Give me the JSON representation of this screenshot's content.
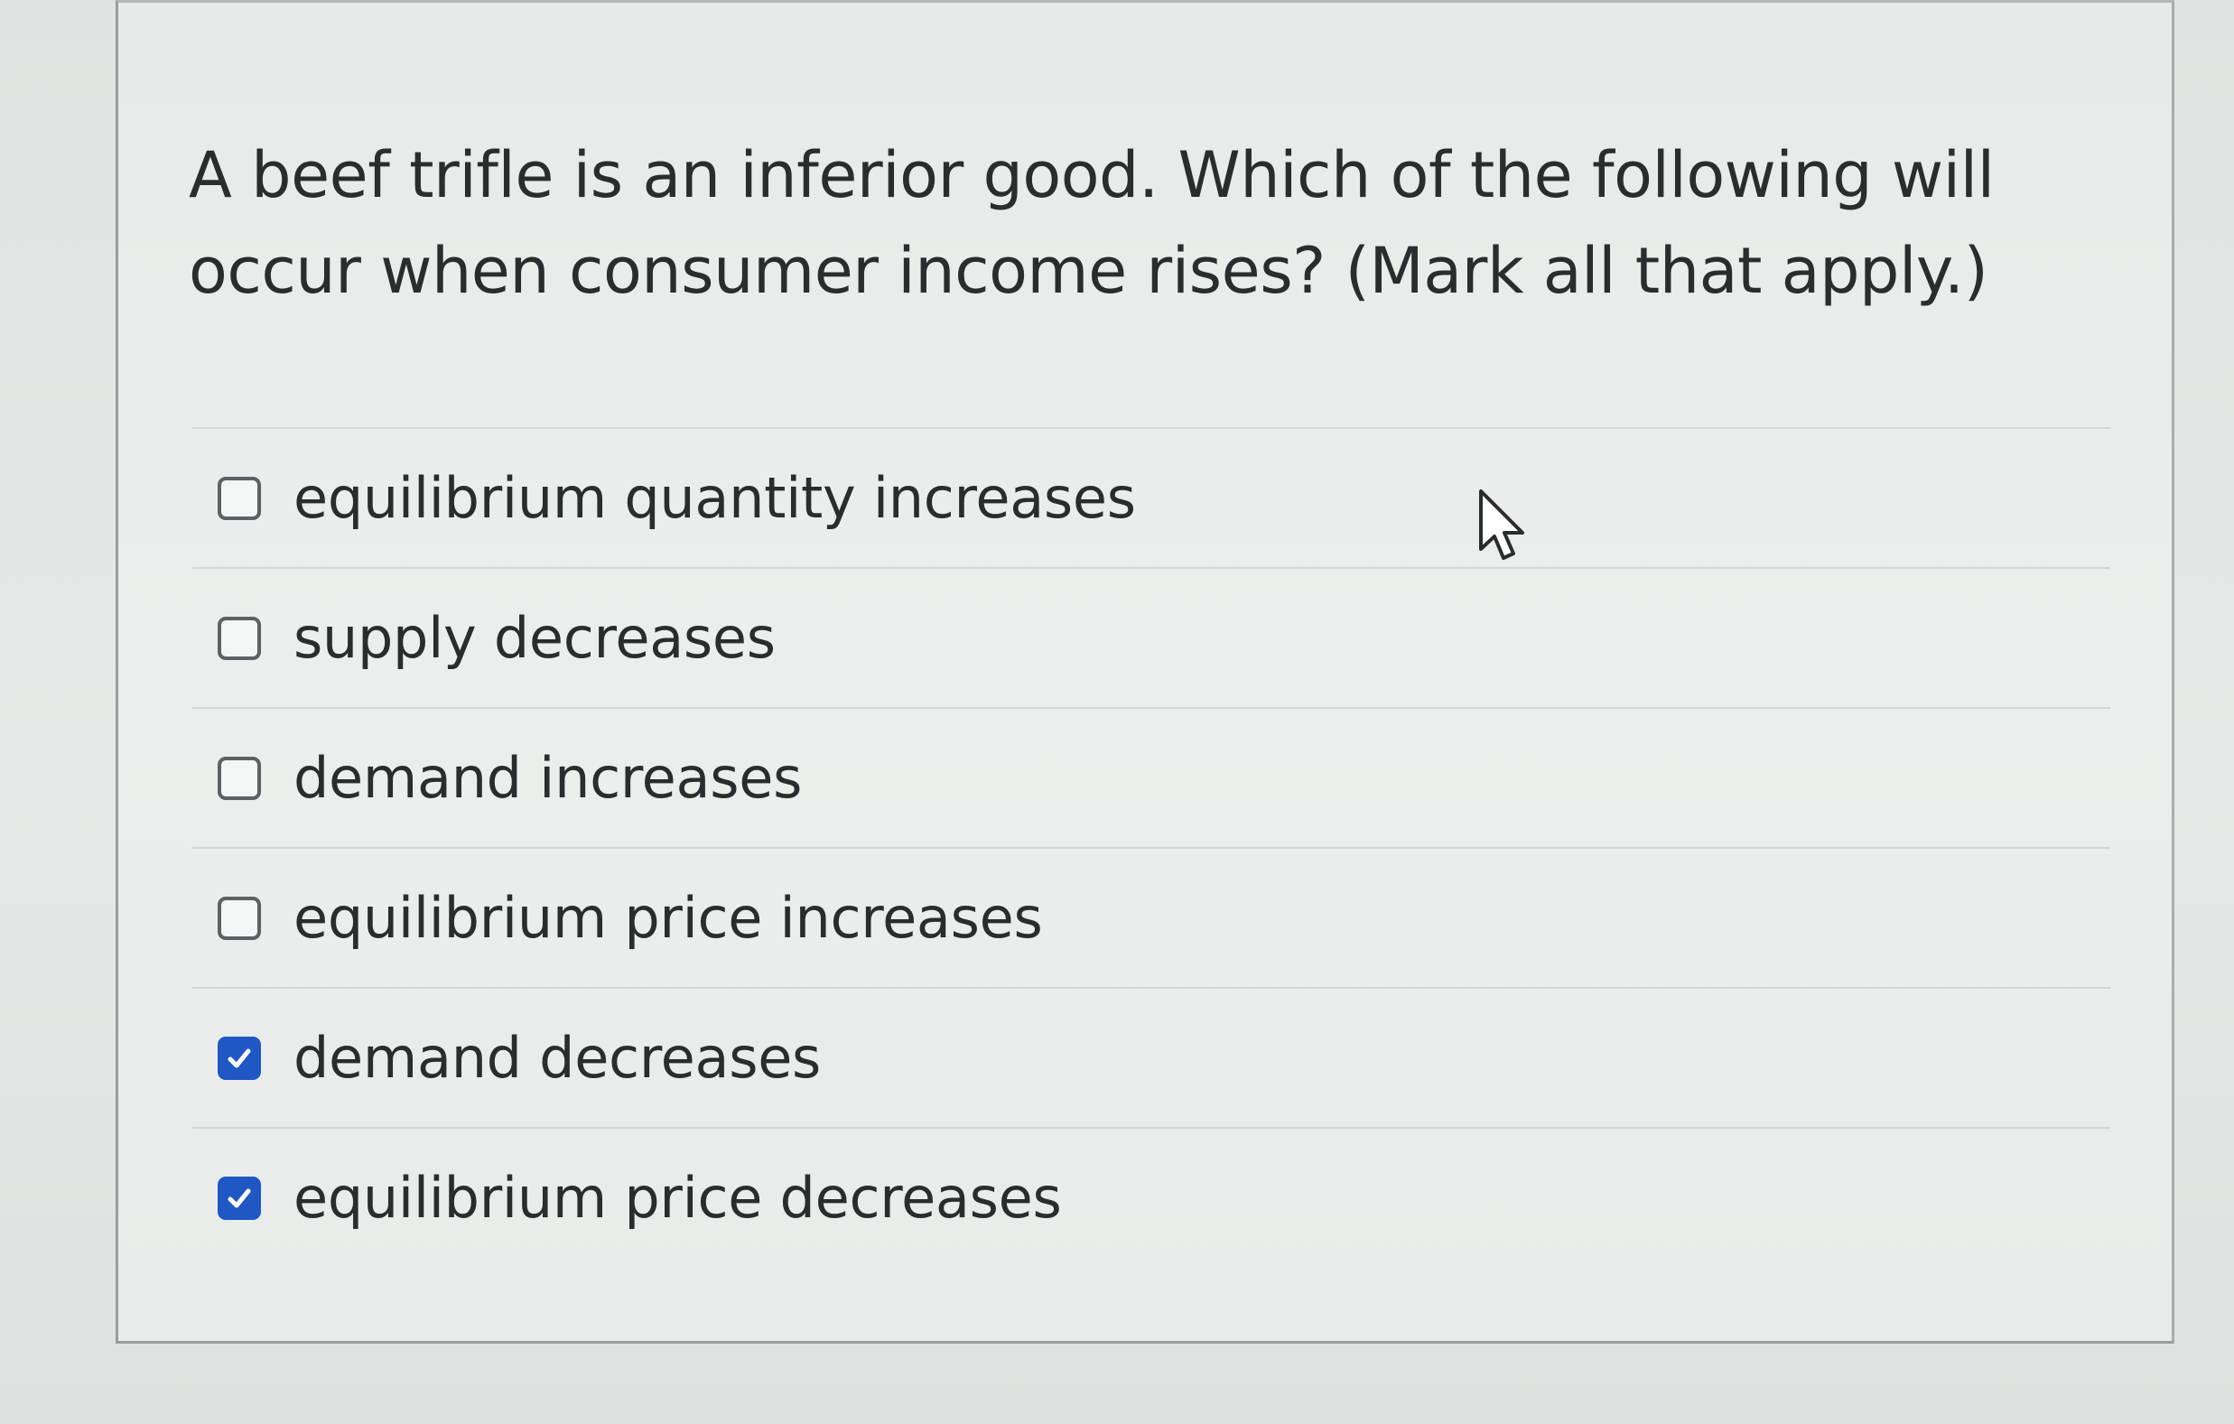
{
  "question": {
    "text": "A beef trifle is an inferior good. Which of the following will occur when consumer income rises? (Mark all that apply.)"
  },
  "options": [
    {
      "label": "equilibrium quantity increases",
      "checked": false
    },
    {
      "label": "supply decreases",
      "checked": false
    },
    {
      "label": "demand increases",
      "checked": false
    },
    {
      "label": "equilibrium price increases",
      "checked": false
    },
    {
      "label": "demand decreases",
      "checked": true
    },
    {
      "label": "equilibrium price decreases",
      "checked": true
    }
  ],
  "colors": {
    "checkbox_checked": "#1f57c4",
    "checkbox_border": "#5e6163",
    "text": "#2a2c2d"
  },
  "icons": {
    "checkmark": "check-icon",
    "pointer": "mouse-pointer-icon"
  }
}
